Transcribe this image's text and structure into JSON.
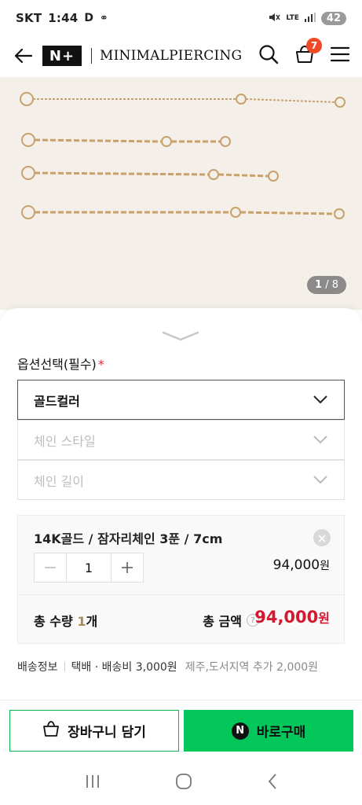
{
  "status_bar": {
    "carrier": "SKT",
    "time": "1:44",
    "network": "LTE",
    "battery": "42"
  },
  "header": {
    "logo_text": "N+",
    "brand_name": "MINIMALPIERCING",
    "cart_count": "7",
    "icons": [
      "back-arrow-icon",
      "search-icon",
      "cart-icon",
      "menu-icon"
    ]
  },
  "product_image": {
    "current": "1",
    "separator": " / ",
    "total": "8"
  },
  "options": {
    "title": "옵션선택(필수)",
    "required_mark": "*",
    "selects": [
      {
        "label": "골드컬러",
        "state": "active"
      },
      {
        "label": "체인 스타일",
        "state": "disabled"
      },
      {
        "label": "체인 길이",
        "state": "disabled"
      }
    ]
  },
  "selected_option": {
    "name": "14K골드 / 잠자리체인 3푼 / 7cm",
    "quantity": "1",
    "price": "94,000",
    "currency": "원"
  },
  "totals": {
    "qty_label": "총 수량 ",
    "qty_value": "1",
    "qty_unit": "개",
    "amount_label": "총 금액",
    "help": "?",
    "amount": "94,000",
    "currency": "원"
  },
  "shipping": {
    "label": "배송정보",
    "method": "택배 · 배송비 3,000원",
    "extra": "제주,도서지역 추가 2,000원"
  },
  "actions": {
    "cart_label": "장바구니 담기",
    "buy_label": "바로구매",
    "npay_mark": "N"
  },
  "colors": {
    "accent_green": "#03c75a",
    "price_red": "#d4182f",
    "badge_orange": "#f04a26",
    "qty_gold": "#a98a5b"
  }
}
